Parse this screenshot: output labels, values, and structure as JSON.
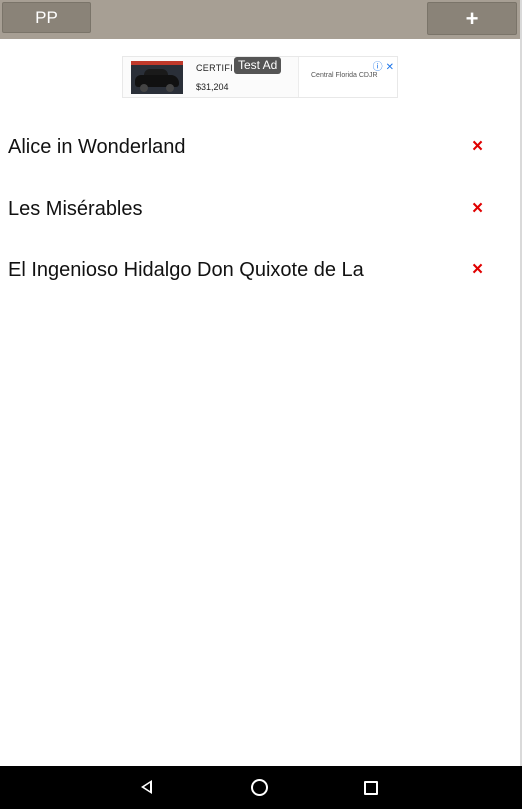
{
  "toolbar": {
    "pp_label": "PP",
    "add_label": "+"
  },
  "ad": {
    "badge": "Test Ad",
    "headline": "CERTIFI",
    "price": "$31,204",
    "advertiser": "Central Florida CDJR"
  },
  "books": [
    {
      "title": "Alice in Wonderland",
      "delete_icon": "×"
    },
    {
      "title": "Les Misérables",
      "delete_icon": "×"
    },
    {
      "title": "El Ingenioso Hidalgo Don Quixote de La",
      "delete_icon": "×"
    }
  ],
  "colors": {
    "toolbar": "#a79f94",
    "button": "#8a8378",
    "delete": "#e00000",
    "navbar": "#000000"
  }
}
